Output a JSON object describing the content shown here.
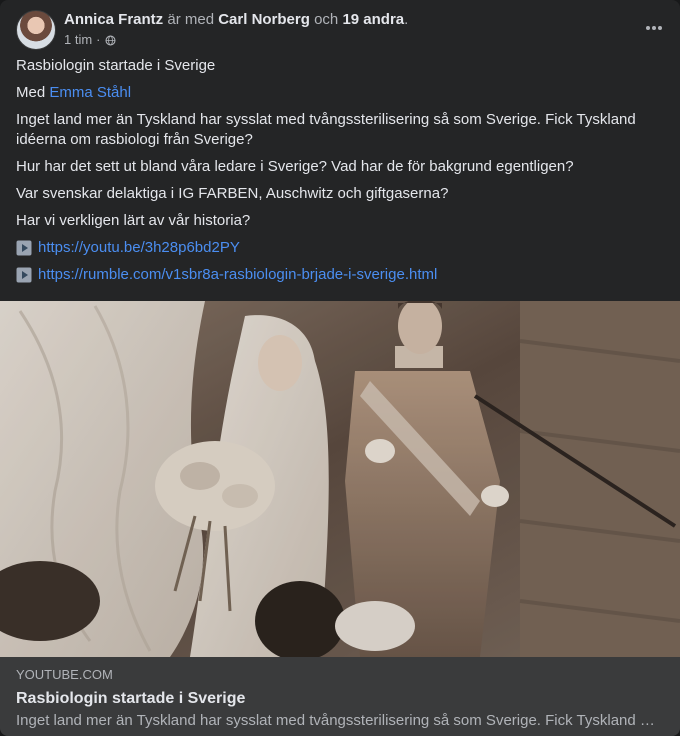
{
  "post": {
    "author_name": "Annica Frantz",
    "with_text": "är med",
    "tagged_name": "Carl Norberg",
    "and_text": "och",
    "others_text": "19 andra",
    "period": ".",
    "time": "1 tim",
    "separator": "·",
    "privacy_icon": "globe-icon",
    "more_icon": "more-dots-icon",
    "content": {
      "title_line": "Rasbiologin startade i Sverige",
      "with_prefix": "Med",
      "with_person": "Emma Ståhl",
      "paragraph_1": "Inget land mer än Tyskland har sysslat med tvångssterilisering så som Sverige. Fick Tyskland idéerna om rasbiologi från Sverige?",
      "paragraph_2": "Hur har det sett ut bland våra ledare i Sverige? Vad har de för bakgrund egentligen?",
      "paragraph_3": "Var svenskar delaktiga i IG FARBEN, Auschwitz och giftgaserna?",
      "paragraph_4": "Har vi verkligen lärt av vår historia?",
      "links": [
        {
          "icon": "video-play-icon",
          "url": "https://youtu.be/3h28p6bd2PY"
        },
        {
          "icon": "video-play-icon",
          "url": "https://rumble.com/v1sbr8a-rasbiologin-brjade-i-sverige.html"
        }
      ]
    },
    "link_preview": {
      "domain": "YOUTUBE.COM",
      "title": "Rasbiologin startade i Sverige",
      "description": "Inget land mer än Tyskland har sysslat med tvångssterilisering så som Sverige. Fick Tyskland …"
    }
  },
  "colors": {
    "card_background": "#242526",
    "caption_background": "#3a3b3c",
    "link_blue": "#4b8ef1",
    "primary_text": "#e4e6eb",
    "secondary_text": "#b0b3b8"
  }
}
